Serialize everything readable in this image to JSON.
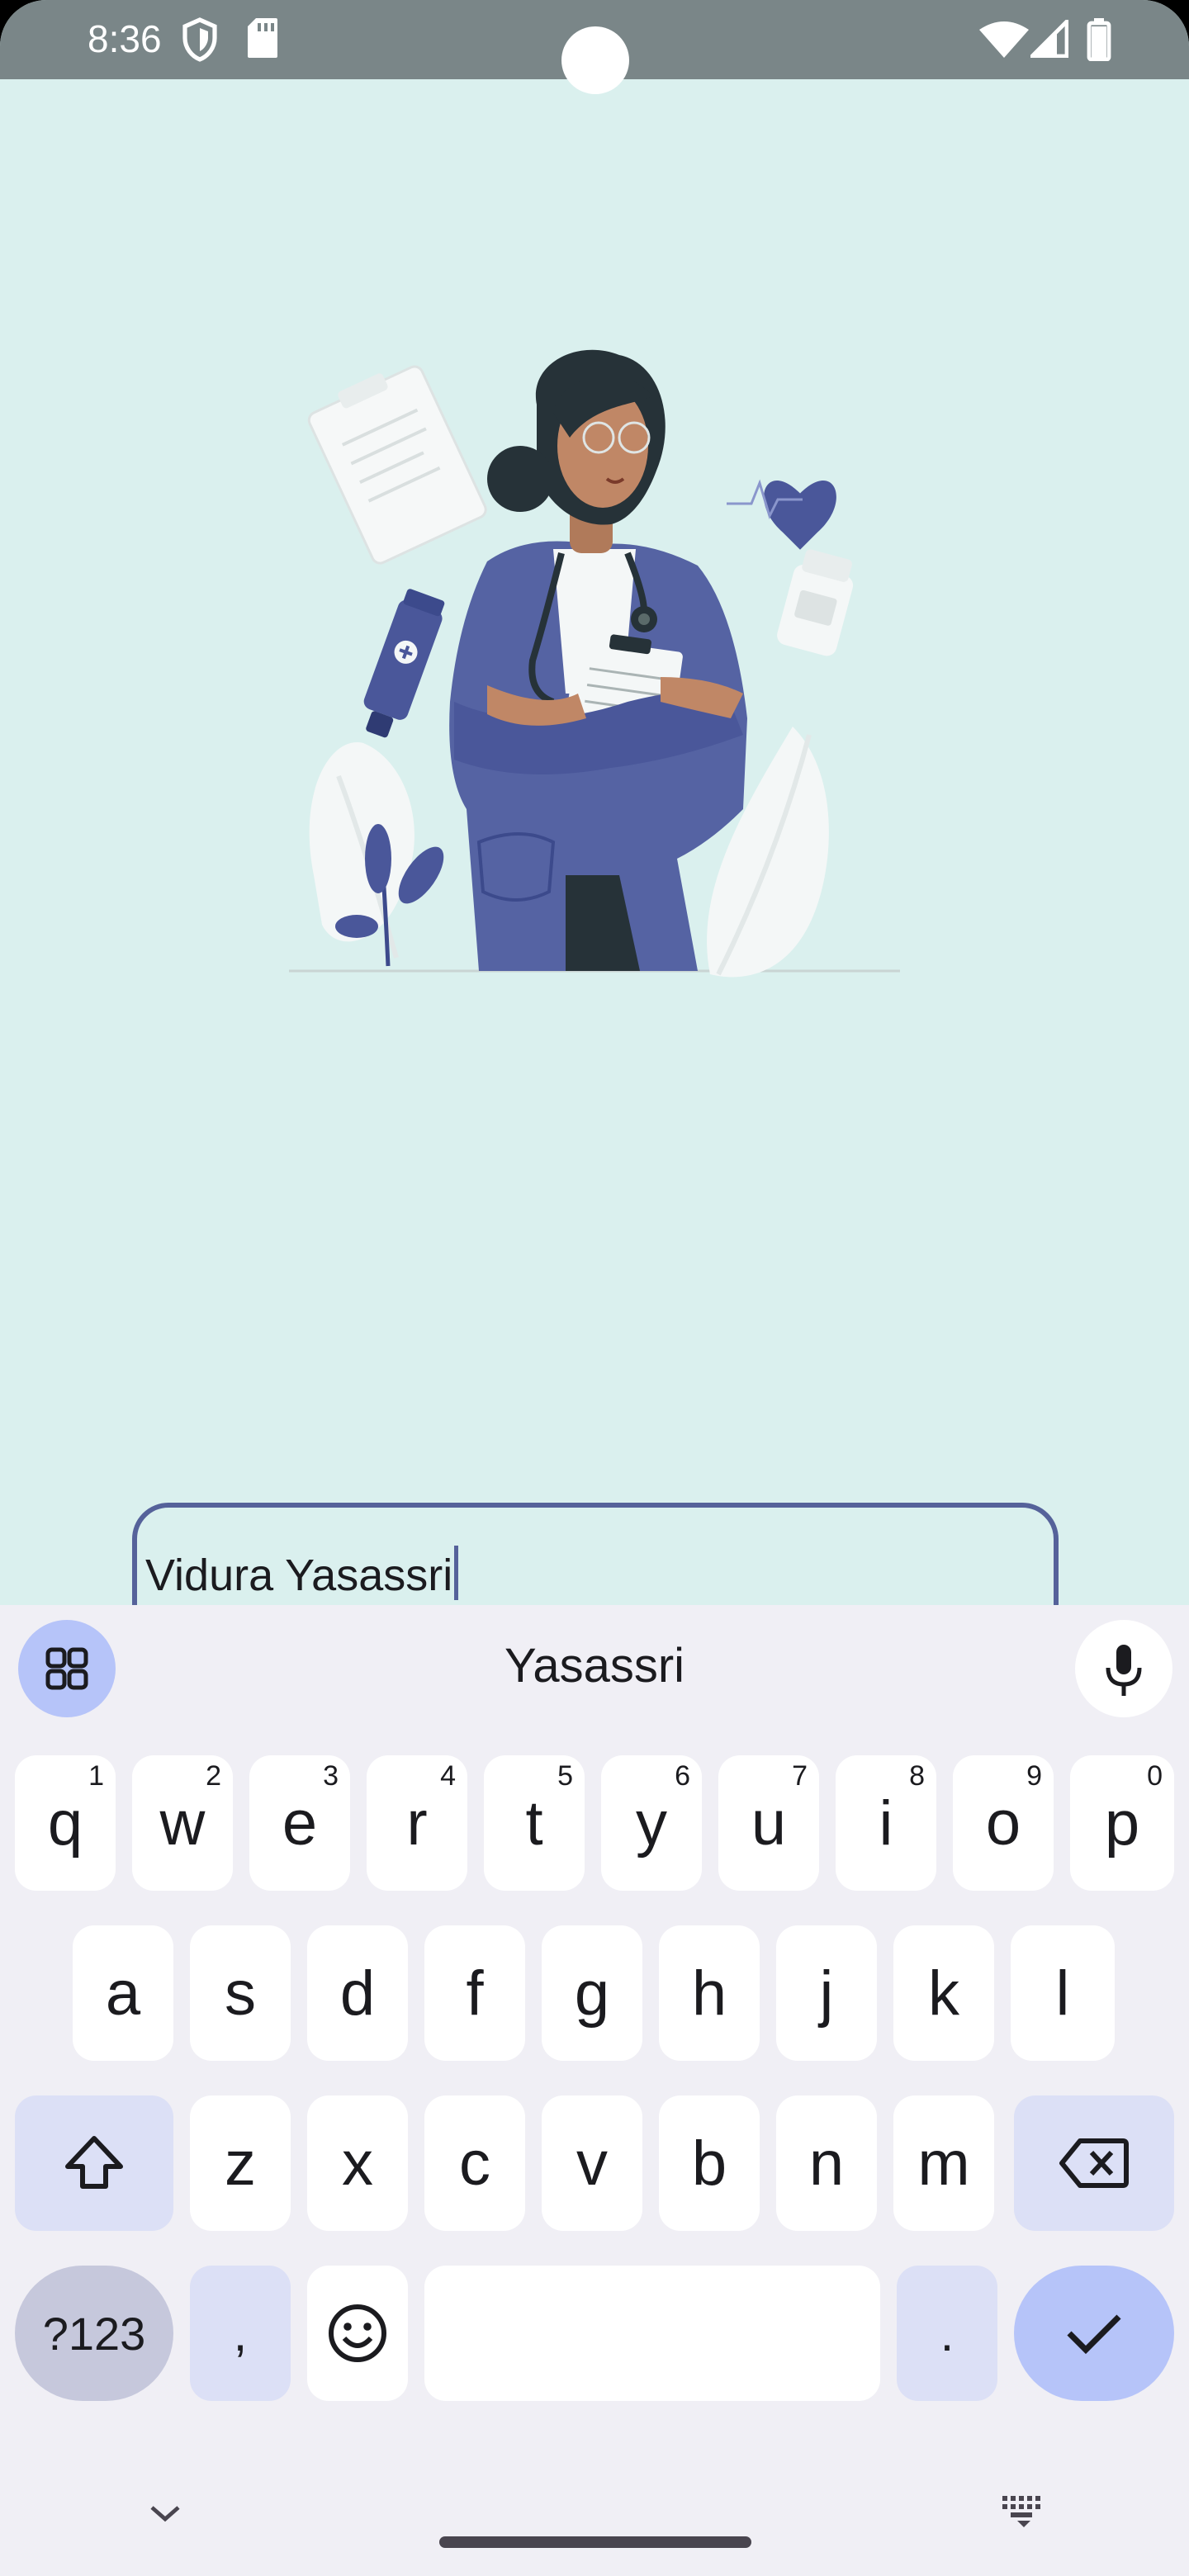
{
  "status_bar": {
    "time": "8:36",
    "icons": [
      "shield-icon",
      "sd-card-icon",
      "wifi-icon",
      "signal-icon",
      "battery-icon"
    ]
  },
  "illustration": {
    "subject": "doctor-illustration",
    "colors": {
      "background": "#daf0ee",
      "coat": "#5563a3",
      "accent": "#4a579a"
    }
  },
  "name_input": {
    "value": "Vidura Yasassri"
  },
  "keyboard": {
    "suggestion": "Yasassri",
    "rows": [
      [
        {
          "label": "q",
          "hint": "1"
        },
        {
          "label": "w",
          "hint": "2"
        },
        {
          "label": "e",
          "hint": "3"
        },
        {
          "label": "r",
          "hint": "4"
        },
        {
          "label": "t",
          "hint": "5"
        },
        {
          "label": "y",
          "hint": "6"
        },
        {
          "label": "u",
          "hint": "7"
        },
        {
          "label": "i",
          "hint": "8"
        },
        {
          "label": "o",
          "hint": "9"
        },
        {
          "label": "p",
          "hint": "0"
        }
      ],
      [
        {
          "label": "a"
        },
        {
          "label": "s"
        },
        {
          "label": "d"
        },
        {
          "label": "f"
        },
        {
          "label": "g"
        },
        {
          "label": "h"
        },
        {
          "label": "j"
        },
        {
          "label": "k"
        },
        {
          "label": "l"
        }
      ],
      [
        {
          "label": "z"
        },
        {
          "label": "x"
        },
        {
          "label": "c"
        },
        {
          "label": "v"
        },
        {
          "label": "b"
        },
        {
          "label": "n"
        },
        {
          "label": "m"
        }
      ]
    ],
    "symbols_label": "?123",
    "comma_label": ",",
    "period_label": ".",
    "icons": {
      "apps": "apps-grid-icon",
      "mic": "microphone-icon",
      "shift": "shift-icon",
      "backspace": "backspace-icon",
      "emoji": "emoji-icon",
      "enter": "checkmark-icon",
      "hide": "chevron-down-icon",
      "switch": "keyboard-icon"
    },
    "colors": {
      "panel": "#f0eff5",
      "key": "#ffffff",
      "modifier": "#dce0f6",
      "accent": "#b6c4f9"
    }
  }
}
